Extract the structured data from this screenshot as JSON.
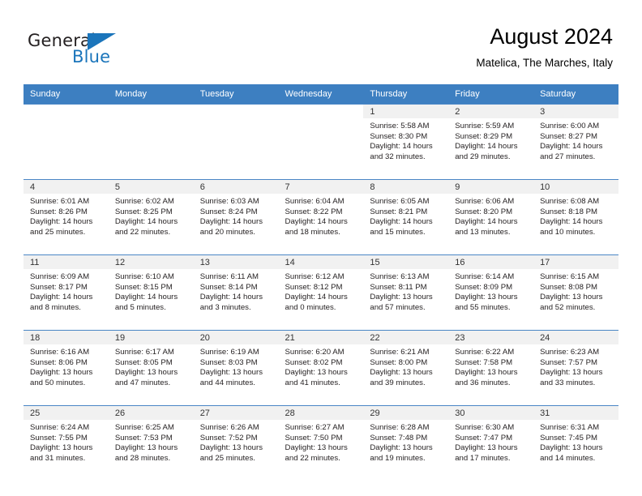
{
  "brand": {
    "name_top": "General",
    "name_bottom": "Blue",
    "accent_color": "#1b75bb"
  },
  "header": {
    "title": "August 2024",
    "subtitle": "Matelica, The Marches, Italy"
  },
  "theme": {
    "header_row_bg": "#3d7fc1",
    "daynum_bg": "#f1f1f1",
    "cell_border": "#4a86c5",
    "text_color": "#231f20"
  },
  "calendar": {
    "weekday_headers": [
      "Sunday",
      "Monday",
      "Tuesday",
      "Wednesday",
      "Thursday",
      "Friday",
      "Saturday"
    ],
    "weeks": [
      [
        {
          "day": "",
          "lines": []
        },
        {
          "day": "",
          "lines": []
        },
        {
          "day": "",
          "lines": []
        },
        {
          "day": "",
          "lines": []
        },
        {
          "day": "1",
          "lines": [
            "Sunrise: 5:58 AM",
            "Sunset: 8:30 PM",
            "Daylight: 14 hours",
            "and 32 minutes."
          ]
        },
        {
          "day": "2",
          "lines": [
            "Sunrise: 5:59 AM",
            "Sunset: 8:29 PM",
            "Daylight: 14 hours",
            "and 29 minutes."
          ]
        },
        {
          "day": "3",
          "lines": [
            "Sunrise: 6:00 AM",
            "Sunset: 8:27 PM",
            "Daylight: 14 hours",
            "and 27 minutes."
          ]
        }
      ],
      [
        {
          "day": "4",
          "lines": [
            "Sunrise: 6:01 AM",
            "Sunset: 8:26 PM",
            "Daylight: 14 hours",
            "and 25 minutes."
          ]
        },
        {
          "day": "5",
          "lines": [
            "Sunrise: 6:02 AM",
            "Sunset: 8:25 PM",
            "Daylight: 14 hours",
            "and 22 minutes."
          ]
        },
        {
          "day": "6",
          "lines": [
            "Sunrise: 6:03 AM",
            "Sunset: 8:24 PM",
            "Daylight: 14 hours",
            "and 20 minutes."
          ]
        },
        {
          "day": "7",
          "lines": [
            "Sunrise: 6:04 AM",
            "Sunset: 8:22 PM",
            "Daylight: 14 hours",
            "and 18 minutes."
          ]
        },
        {
          "day": "8",
          "lines": [
            "Sunrise: 6:05 AM",
            "Sunset: 8:21 PM",
            "Daylight: 14 hours",
            "and 15 minutes."
          ]
        },
        {
          "day": "9",
          "lines": [
            "Sunrise: 6:06 AM",
            "Sunset: 8:20 PM",
            "Daylight: 14 hours",
            "and 13 minutes."
          ]
        },
        {
          "day": "10",
          "lines": [
            "Sunrise: 6:08 AM",
            "Sunset: 8:18 PM",
            "Daylight: 14 hours",
            "and 10 minutes."
          ]
        }
      ],
      [
        {
          "day": "11",
          "lines": [
            "Sunrise: 6:09 AM",
            "Sunset: 8:17 PM",
            "Daylight: 14 hours",
            "and 8 minutes."
          ]
        },
        {
          "day": "12",
          "lines": [
            "Sunrise: 6:10 AM",
            "Sunset: 8:15 PM",
            "Daylight: 14 hours",
            "and 5 minutes."
          ]
        },
        {
          "day": "13",
          "lines": [
            "Sunrise: 6:11 AM",
            "Sunset: 8:14 PM",
            "Daylight: 14 hours",
            "and 3 minutes."
          ]
        },
        {
          "day": "14",
          "lines": [
            "Sunrise: 6:12 AM",
            "Sunset: 8:12 PM",
            "Daylight: 14 hours",
            "and 0 minutes."
          ]
        },
        {
          "day": "15",
          "lines": [
            "Sunrise: 6:13 AM",
            "Sunset: 8:11 PM",
            "Daylight: 13 hours",
            "and 57 minutes."
          ]
        },
        {
          "day": "16",
          "lines": [
            "Sunrise: 6:14 AM",
            "Sunset: 8:09 PM",
            "Daylight: 13 hours",
            "and 55 minutes."
          ]
        },
        {
          "day": "17",
          "lines": [
            "Sunrise: 6:15 AM",
            "Sunset: 8:08 PM",
            "Daylight: 13 hours",
            "and 52 minutes."
          ]
        }
      ],
      [
        {
          "day": "18",
          "lines": [
            "Sunrise: 6:16 AM",
            "Sunset: 8:06 PM",
            "Daylight: 13 hours",
            "and 50 minutes."
          ]
        },
        {
          "day": "19",
          "lines": [
            "Sunrise: 6:17 AM",
            "Sunset: 8:05 PM",
            "Daylight: 13 hours",
            "and 47 minutes."
          ]
        },
        {
          "day": "20",
          "lines": [
            "Sunrise: 6:19 AM",
            "Sunset: 8:03 PM",
            "Daylight: 13 hours",
            "and 44 minutes."
          ]
        },
        {
          "day": "21",
          "lines": [
            "Sunrise: 6:20 AM",
            "Sunset: 8:02 PM",
            "Daylight: 13 hours",
            "and 41 minutes."
          ]
        },
        {
          "day": "22",
          "lines": [
            "Sunrise: 6:21 AM",
            "Sunset: 8:00 PM",
            "Daylight: 13 hours",
            "and 39 minutes."
          ]
        },
        {
          "day": "23",
          "lines": [
            "Sunrise: 6:22 AM",
            "Sunset: 7:58 PM",
            "Daylight: 13 hours",
            "and 36 minutes."
          ]
        },
        {
          "day": "24",
          "lines": [
            "Sunrise: 6:23 AM",
            "Sunset: 7:57 PM",
            "Daylight: 13 hours",
            "and 33 minutes."
          ]
        }
      ],
      [
        {
          "day": "25",
          "lines": [
            "Sunrise: 6:24 AM",
            "Sunset: 7:55 PM",
            "Daylight: 13 hours",
            "and 31 minutes."
          ]
        },
        {
          "day": "26",
          "lines": [
            "Sunrise: 6:25 AM",
            "Sunset: 7:53 PM",
            "Daylight: 13 hours",
            "and 28 minutes."
          ]
        },
        {
          "day": "27",
          "lines": [
            "Sunrise: 6:26 AM",
            "Sunset: 7:52 PM",
            "Daylight: 13 hours",
            "and 25 minutes."
          ]
        },
        {
          "day": "28",
          "lines": [
            "Sunrise: 6:27 AM",
            "Sunset: 7:50 PM",
            "Daylight: 13 hours",
            "and 22 minutes."
          ]
        },
        {
          "day": "29",
          "lines": [
            "Sunrise: 6:28 AM",
            "Sunset: 7:48 PM",
            "Daylight: 13 hours",
            "and 19 minutes."
          ]
        },
        {
          "day": "30",
          "lines": [
            "Sunrise: 6:30 AM",
            "Sunset: 7:47 PM",
            "Daylight: 13 hours",
            "and 17 minutes."
          ]
        },
        {
          "day": "31",
          "lines": [
            "Sunrise: 6:31 AM",
            "Sunset: 7:45 PM",
            "Daylight: 13 hours",
            "and 14 minutes."
          ]
        }
      ]
    ]
  }
}
